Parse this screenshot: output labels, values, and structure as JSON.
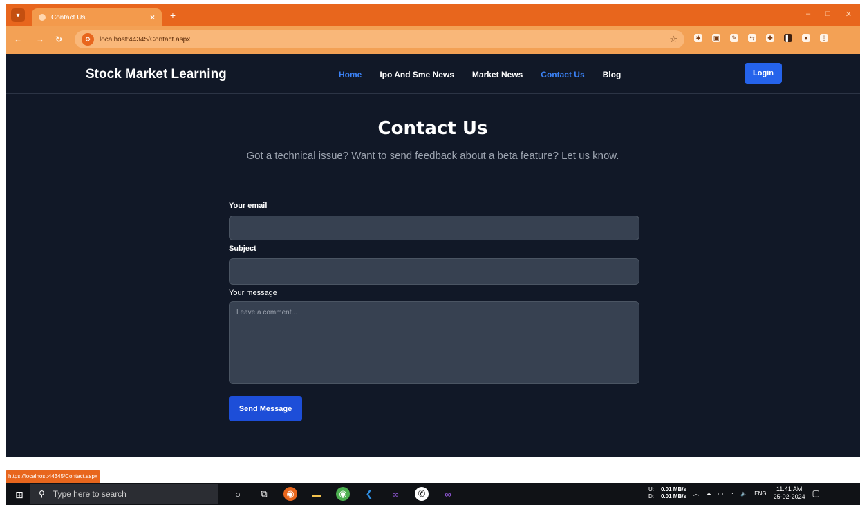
{
  "browser": {
    "tab_title": "Contact Us",
    "tab_close": "×",
    "new_tab": "+",
    "url": "localhost:44345/Contact.aspx",
    "status_url": "https://localhost:44345/Contact.aspx",
    "window_controls": [
      "–",
      "□",
      "✕"
    ]
  },
  "navbar": {
    "brand": "Stock Market Learning",
    "links": [
      {
        "label": "Home",
        "active": true
      },
      {
        "label": "Ipo And Sme News",
        "active": false
      },
      {
        "label": "Market News",
        "active": false
      },
      {
        "label": "Contact Us",
        "active": true
      },
      {
        "label": "Blog",
        "active": false
      }
    ],
    "login": "Login"
  },
  "page": {
    "title": "Contact Us",
    "subtitle": "Got a technical issue? Want to send feedback about a beta feature? Let us know."
  },
  "form": {
    "email_label": "Your email",
    "subject_label": "Subject",
    "message_label": "Your message",
    "message_placeholder": "Leave a comment...",
    "send": "Send Message"
  },
  "taskbar": {
    "search_placeholder": "Type here to search",
    "upload_label": "U:",
    "download_label": "D:",
    "upload_speed": "0.01 MB/s",
    "download_speed": "0.01 MB/s",
    "language": "ENG",
    "time": "11:41 AM",
    "date": "25-02-2024"
  },
  "colors": {
    "accent": "#2563eb",
    "active_link": "#3b82f6",
    "page_bg": "#111827",
    "chrome_orange": "#e8661d"
  }
}
